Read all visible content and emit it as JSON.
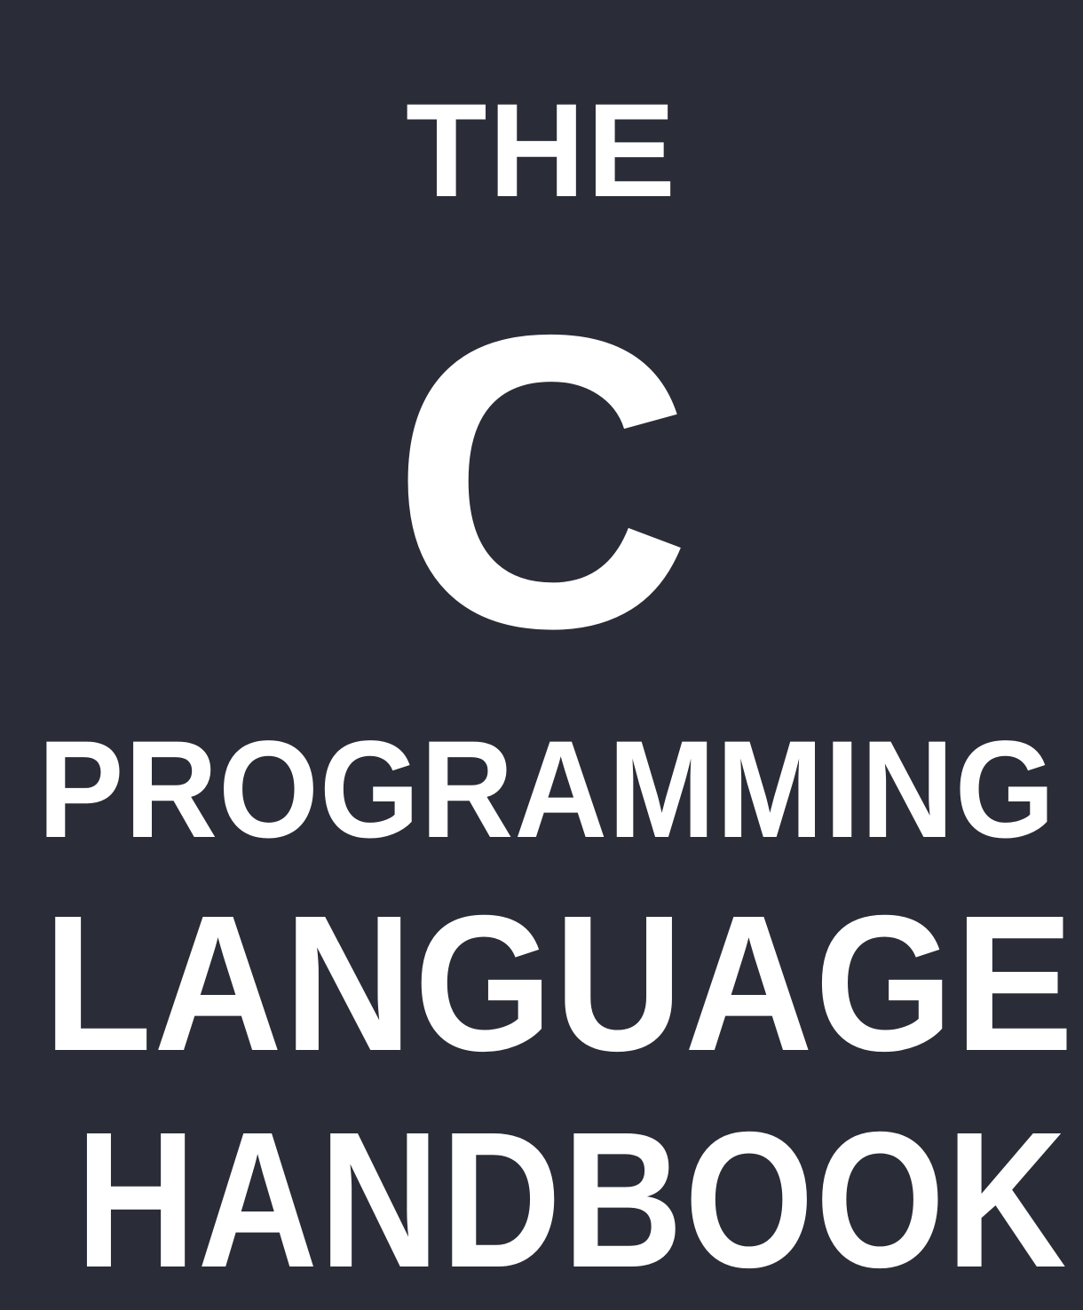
{
  "cover": {
    "background_color": "#2a2c37",
    "text_color": "#ffffff",
    "line_the": "THE",
    "line_c": "C",
    "line_programming": "PROGRAMMING",
    "line_language": "LANGUAGE",
    "line_handbook": "HANDBOOK"
  }
}
